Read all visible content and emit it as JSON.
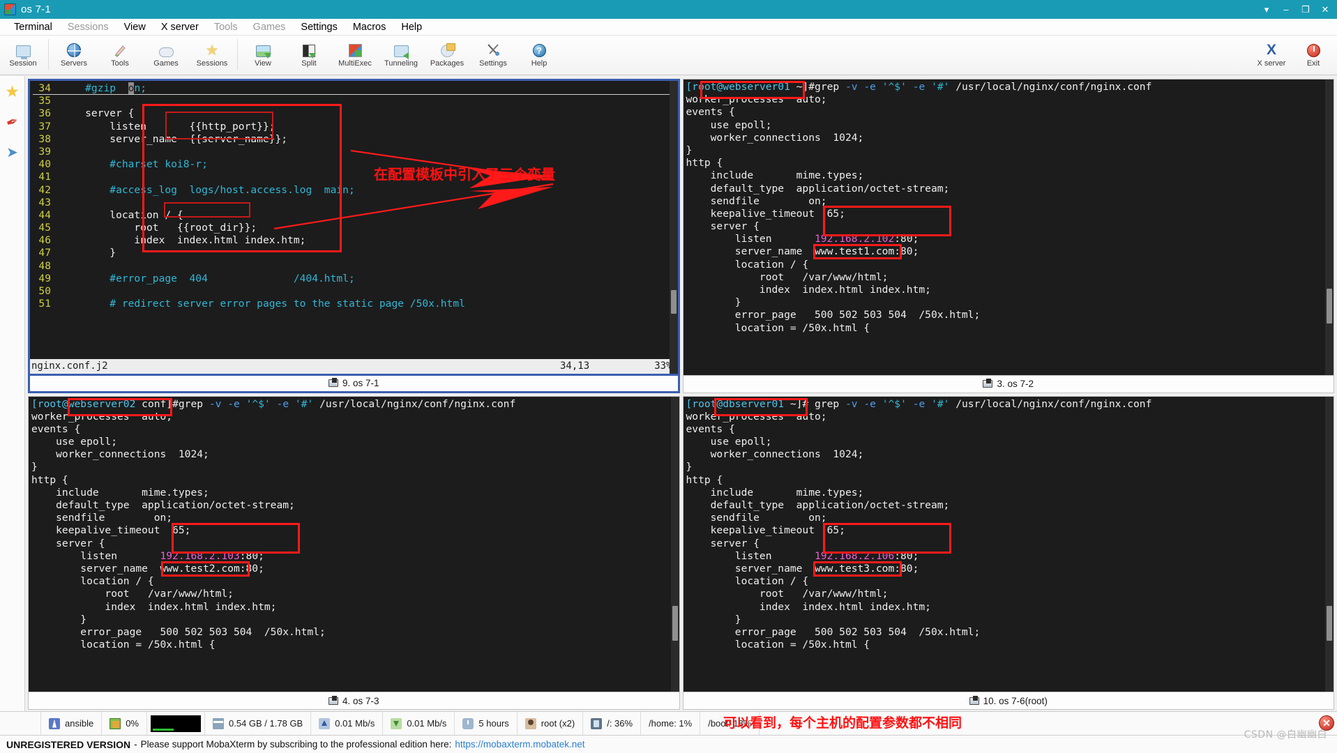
{
  "window": {
    "title": "os 7-1",
    "icon": "mobaxterm-icon",
    "buttons": [
      {
        "name": "dropdown-button",
        "glyph": "▾"
      },
      {
        "name": "minimize-button",
        "glyph": "–"
      },
      {
        "name": "maximize-button",
        "glyph": "❐"
      },
      {
        "name": "close-button",
        "glyph": "✕"
      }
    ]
  },
  "menubar": [
    {
      "label": "Terminal",
      "enabled": true
    },
    {
      "label": "Sessions",
      "enabled": false
    },
    {
      "label": "View",
      "enabled": true
    },
    {
      "label": "X server",
      "enabled": true
    },
    {
      "label": "Tools",
      "enabled": false
    },
    {
      "label": "Games",
      "enabled": false
    },
    {
      "label": "Settings",
      "enabled": true
    },
    {
      "label": "Macros",
      "enabled": true
    },
    {
      "label": "Help",
      "enabled": true
    }
  ],
  "toolbar": {
    "items": [
      {
        "label": "Session",
        "icon": "session-icon"
      },
      {
        "label": "Servers",
        "icon": "servers-globe-icon"
      },
      {
        "label": "Tools",
        "icon": "tools-icon"
      },
      {
        "label": "Games",
        "icon": "games-gamepad-icon"
      },
      {
        "label": "Sessions",
        "icon": "sessions-star-icon"
      },
      {
        "label": "View",
        "icon": "view-image-icon"
      },
      {
        "label": "Split",
        "icon": "split-icon"
      },
      {
        "label": "MultiExec",
        "icon": "multiexec-icon"
      },
      {
        "label": "Tunneling",
        "icon": "tunneling-icon"
      },
      {
        "label": "Packages",
        "icon": "packages-icon"
      },
      {
        "label": "Settings",
        "icon": "settings-wrench-icon"
      },
      {
        "label": "Help",
        "icon": "help-question-icon"
      }
    ],
    "right": [
      {
        "label": "X server",
        "icon": "x-server-icon"
      },
      {
        "label": "Exit",
        "icon": "exit-power-icon"
      }
    ]
  },
  "sidebar": {
    "items": [
      {
        "name": "favorites-star-icon",
        "glyph": "★"
      },
      {
        "name": "pin-icon",
        "glyph": "✒"
      },
      {
        "name": "send-icon",
        "glyph": "➤"
      }
    ]
  },
  "panes": {
    "editor": {
      "title": "9. os 7-1",
      "active": true,
      "filename": "nginx.conf.j2",
      "position": "34,13",
      "percent": "33%",
      "annotation": "在配置模板中引入了三个变量",
      "lines": [
        {
          "n": "34",
          "text": "    #gzip  on;",
          "cls": "c-cyan",
          "cursor_at": 11,
          "underline": true
        },
        {
          "n": "35",
          "text": "",
          "cls": "c-white"
        },
        {
          "n": "36",
          "text": "    server {",
          "cls": "c-white"
        },
        {
          "n": "37",
          "text": "        listen       {{http_port}};",
          "cls": "c-white"
        },
        {
          "n": "38",
          "text": "        server_name  {{server_name}};",
          "cls": "c-white"
        },
        {
          "n": "39",
          "text": "",
          "cls": "c-white"
        },
        {
          "n": "40",
          "text": "        #charset koi8-r;",
          "cls": "c-cyan"
        },
        {
          "n": "41",
          "text": "",
          "cls": "c-white"
        },
        {
          "n": "42",
          "text": "        #access_log  logs/host.access.log  main;",
          "cls": "c-cyan"
        },
        {
          "n": "43",
          "text": "",
          "cls": "c-white"
        },
        {
          "n": "44",
          "text": "        location / {",
          "cls": "c-white"
        },
        {
          "n": "45",
          "text": "            root   {{root_dir}};",
          "cls": "c-white"
        },
        {
          "n": "46",
          "text": "            index  index.html index.htm;",
          "cls": "c-white"
        },
        {
          "n": "47",
          "text": "        }",
          "cls": "c-white"
        },
        {
          "n": "48",
          "text": "",
          "cls": "c-white"
        },
        {
          "n": "49",
          "text": "        #error_page  404              /404.html;",
          "cls": "c-cyan"
        },
        {
          "n": "50",
          "text": "",
          "cls": "c-white"
        },
        {
          "n": "51",
          "text": "        # redirect server error pages to the static page /50x.html",
          "cls": "c-cyan"
        }
      ]
    },
    "webserver01": {
      "title": "3. os 7-2",
      "active": false,
      "prompt_user": "[root",
      "prompt_host": "@webserver01",
      "prompt_tail": " ~]#",
      "command": "grep -v -e '^$' -e '#' /usr/local/nginx/conf/nginx.conf",
      "listen_ip": "192.168.2.102",
      "listen_port": ":80;",
      "server_name": "www.test1.com:80;",
      "root_dir": "/var/www/html;",
      "lines": [
        "worker_processes  auto;",
        "events {",
        "    use epoll;",
        "    worker_connections  1024;",
        "}",
        "http {",
        "    include       mime.types;",
        "    default_type  application/octet-stream;",
        "    sendfile        on;",
        "    keepalive_timeout  65;",
        "    server {",
        "        listen       ",
        "        server_name  ",
        "        location / {",
        "            root   ",
        "            index  index.html index.htm;",
        "        }",
        "        error_page   500 502 503 504  /50x.html;",
        "        location = /50x.html {"
      ]
    },
    "webserver02": {
      "title": "4. os 7-3",
      "active": false,
      "prompt_user": "[root",
      "prompt_host": "@webserver02",
      "prompt_tail": " conf]#",
      "command": "grep -v -e '^$' -e '#' /usr/local/nginx/conf/nginx.conf",
      "listen_ip": "192.168.2.103",
      "listen_port": ":80;",
      "server_name": "www.test2.com:80;",
      "root_dir": "/var/www/html;",
      "lines": [
        "worker_processes  auto;",
        "events {",
        "    use epoll;",
        "    worker_connections  1024;",
        "}",
        "http {",
        "    include       mime.types;",
        "    default_type  application/octet-stream;",
        "    sendfile        on;",
        "    keepalive_timeout  65;",
        "    server {",
        "        listen       ",
        "        server_name  ",
        "        location / {",
        "            root   ",
        "            index  index.html index.htm;",
        "        }",
        "        error_page   500 502 503 504  /50x.html;",
        "        location = /50x.html {"
      ]
    },
    "dbserver01": {
      "title": "10. os 7-6(root)",
      "active": false,
      "prompt_user": "[root",
      "prompt_host": "@dbserver01",
      "prompt_tail": " ~]# ",
      "command": "grep -v -e '^$' -e '#' /usr/local/nginx/conf/nginx.conf",
      "listen_ip": "192.168.2.106",
      "listen_port": ":80;",
      "server_name": "www.test3.com:80;",
      "root_dir": "/var/www/html;",
      "lines": [
        "worker_processes  auto;",
        "events {",
        "    use epoll;",
        "    worker_connections  1024;",
        "}",
        "http {",
        "    include       mime.types;",
        "    default_type  application/octet-stream;",
        "    sendfile        on;",
        "    keepalive_timeout  65;",
        "    server {",
        "        listen       ",
        "        server_name  ",
        "        location / {",
        "            root   ",
        "            index  index.html index.htm;",
        "        }",
        "        error_page   500 502 503 504  /50x.html;",
        "        location = /50x.html {"
      ]
    }
  },
  "statusbar": {
    "cells": [
      {
        "icon": "ansible-icon",
        "label": "ansible"
      },
      {
        "icon": "cpu-icon",
        "label": "0%"
      },
      {
        "icon": "blackbox",
        "label": ""
      },
      {
        "icon": "ram-icon",
        "label": "0.54 GB / 1.78 GB"
      },
      {
        "icon": "upload-icon",
        "label": "0.01 Mb/s"
      },
      {
        "icon": "download-icon",
        "label": "0.01 Mb/s"
      },
      {
        "icon": "uptime-clock-icon",
        "label": "5 hours"
      },
      {
        "icon": "user-icon",
        "label": "root (x2)"
      },
      {
        "icon": "disk-icon",
        "label": "/: 36%"
      },
      {
        "icon": "",
        "label": "/home: 1%"
      },
      {
        "icon": "",
        "label": "/boot: 18%"
      }
    ],
    "note": "可以看到，每个主机的配置参数都不相同",
    "close_glyph": "✕"
  },
  "footer": {
    "bold": "UNREGISTERED VERSION",
    "dash": "-",
    "text": "Please support MobaXterm by subscribing to the professional edition here:",
    "link": "https://mobaxterm.mobatek.net"
  },
  "watermark": "CSDN @白幽幽白"
}
